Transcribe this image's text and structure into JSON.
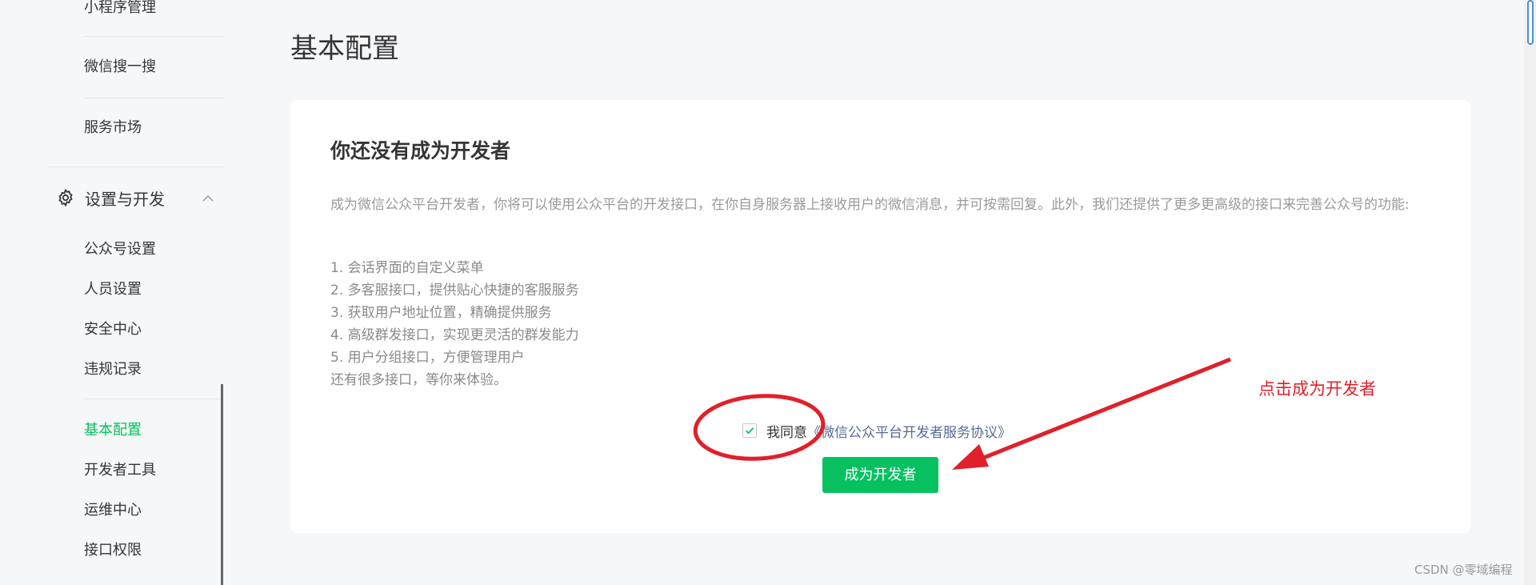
{
  "sidebar": {
    "items_top": [
      {
        "label": "小程序管理"
      },
      {
        "label": "微信搜一搜"
      },
      {
        "label": "服务市场"
      }
    ],
    "section": {
      "label": "设置与开发",
      "icon": "gear-icon",
      "expanded": true
    },
    "section_items": [
      {
        "label": "公众号设置"
      },
      {
        "label": "人员设置"
      },
      {
        "label": "安全中心"
      },
      {
        "label": "违规记录"
      }
    ],
    "dev_items": [
      {
        "label": "基本配置",
        "active": true
      },
      {
        "label": "开发者工具"
      },
      {
        "label": "运维中心"
      },
      {
        "label": "接口权限"
      }
    ]
  },
  "main": {
    "page_title": "基本配置",
    "card": {
      "title": "你还没有成为开发者",
      "description": "成为微信公众平台开发者，你将可以使用公众平台的开发接口，在你自身服务器上接收用户的微信消息，并可按需回复。此外，我们还提供了更多更高级的接口来完善公众号的功能:",
      "features": [
        "1. 会话界面的自定义菜单",
        "2. 多客服接口，提供贴心快捷的客服服务",
        "3. 获取用户地址位置，精确提供服务",
        "4. 高级群发接口，实现更灵活的群发能力",
        "5. 用户分组接口，方便管理用户"
      ],
      "more_text": "还有很多接口，等你来体验。",
      "agree": {
        "checked": true,
        "text": "我同意",
        "link": "《微信公众平台开发者服务协议》"
      },
      "button_label": "成为开发者"
    }
  },
  "annotation": {
    "text": "点击成为开发者",
    "color": "#e0202a"
  },
  "watermark": "CSDN @零域编程",
  "colors": {
    "accent": "#07c160",
    "link": "#576b95"
  }
}
